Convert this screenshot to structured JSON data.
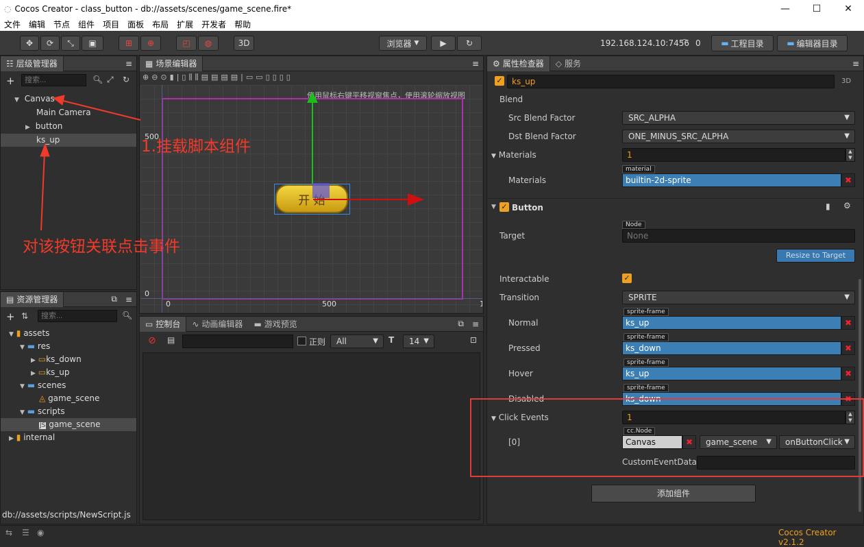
{
  "window": {
    "title": "Cocos Creator - class_button - db://assets/scenes/game_scene.fire*"
  },
  "menu": [
    "文件",
    "编辑",
    "节点",
    "组件",
    "项目",
    "面板",
    "布局",
    "扩展",
    "开发者",
    "帮助"
  ],
  "toolbar": {
    "mode_3d": "3D",
    "browser": "浏览器",
    "ip": "192.168.124.10:7456",
    "conn_count": "0",
    "project_dir": "工程目录",
    "editor_dir": "编辑器目录"
  },
  "hierarchy": {
    "tab": "层级管理器",
    "search_placeholder": "搜索...",
    "items": [
      {
        "label": "Canvas"
      },
      {
        "label": "Main Camera"
      },
      {
        "label": "button"
      },
      {
        "label": "ks_up"
      }
    ]
  },
  "scene": {
    "tab": "场景编辑器",
    "hint": "使用鼠标右键平移视窗焦点，使用滚轮缩放视图",
    "y_label_500": "500",
    "y_label_0": "0",
    "x_label_0": "0",
    "x_label_500": "500",
    "x_label_1": "1",
    "button_text": "开 始"
  },
  "annotations": {
    "a1": "1.挂载脚本组件",
    "a2": "对该按钮关联点击事件"
  },
  "assets": {
    "tab": "资源管理器",
    "search_placeholder": "搜索...",
    "items": [
      {
        "label": "assets"
      },
      {
        "label": "res"
      },
      {
        "label": "ks_down"
      },
      {
        "label": "ks_up"
      },
      {
        "label": "scenes"
      },
      {
        "label": "game_scene"
      },
      {
        "label": "scripts"
      },
      {
        "label": "game_scene"
      },
      {
        "label": "internal"
      }
    ],
    "status_path": "db://assets/scripts/NewScript.js"
  },
  "console": {
    "tabs": [
      "控制台",
      "动画编辑器",
      "游戏预览"
    ],
    "regex_label": "正则",
    "level": "All",
    "font_size": "14"
  },
  "inspector": {
    "tabs": [
      "属性检查器",
      "服务"
    ],
    "node_name": "ks_up",
    "mode_3d": "3D",
    "blend_label": "Blend",
    "src_blend_label": "Src Blend Factor",
    "src_blend_value": "SRC_ALPHA",
    "dst_blend_label": "Dst Blend Factor",
    "dst_blend_value": "ONE_MINUS_SRC_ALPHA",
    "materials_label": "Materials",
    "materials_count": "1",
    "materials_item_label": "Materials",
    "materials_tag": "material",
    "materials_value": "builtin-2d-sprite",
    "button_section": "Button",
    "target_label": "Target",
    "target_tag": "Node",
    "target_value": "None",
    "resize_btn": "Resize to Target",
    "interactable_label": "Interactable",
    "transition_label": "Transition",
    "transition_value": "SPRITE",
    "sf_tag": "sprite-frame",
    "normal_label": "Normal",
    "normal_value": "ks_up",
    "pressed_label": "Pressed",
    "pressed_value": "ks_down",
    "hover_label": "Hover",
    "hover_value": "ks_up",
    "disabled_label": "Disabled",
    "disabled_value": "ks_down",
    "click_events_label": "Click Events",
    "click_events_count": "1",
    "event0_label": "[0]",
    "event_tag": "cc.Node",
    "event_target": "Canvas",
    "event_component": "game_scene",
    "event_handler": "onButtonClick",
    "custom_data_label": "CustomEventData",
    "add_component": "添加组件"
  },
  "footer": {
    "version": "Cocos Creator v2.1.2"
  },
  "colors": {
    "accent": "#f0a020",
    "annotation": "#f23a2a",
    "asset_blue": "#3c7fb4"
  }
}
